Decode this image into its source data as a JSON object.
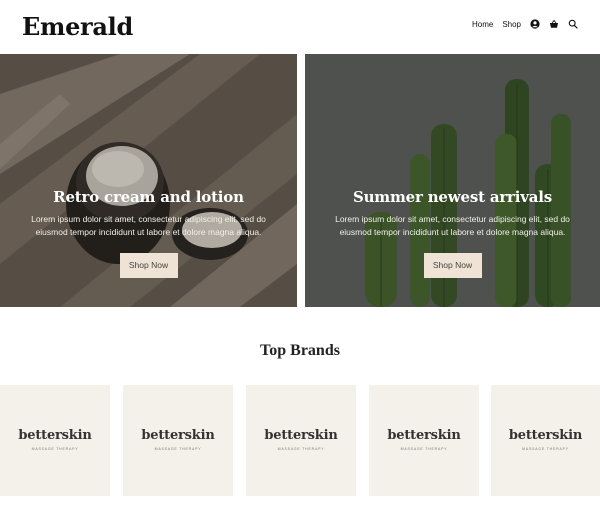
{
  "header": {
    "logo": "Emerald",
    "nav": [
      {
        "label": "Home"
      },
      {
        "label": "Shop"
      }
    ],
    "icons": [
      "account-icon",
      "basket-icon",
      "search-icon"
    ]
  },
  "heroes": [
    {
      "title": "Retro cream and lotion",
      "text": "Lorem ipsum dolor sit amet, consectetur adipiscing elit, sed do eiusmod tempor incididunt ut labore et dolore magna aliqua.",
      "button": "Shop Now"
    },
    {
      "title": "Summer newest arrivals",
      "text": "Lorem ipsum dolor sit amet, consectetur adipiscing elit, sed do eiusmod tempor incididunt ut labore et dolore magna aliqua.",
      "button": "Shop Now"
    }
  ],
  "brands_section": {
    "title": "Top Brands",
    "items": [
      {
        "name": "betterskin",
        "tagline": "MASSAGE THERAPY"
      },
      {
        "name": "betterskin",
        "tagline": "MASSAGE THERAPY"
      },
      {
        "name": "betterskin",
        "tagline": "MASSAGE THERAPY"
      },
      {
        "name": "betterskin",
        "tagline": "MASSAGE THERAPY"
      },
      {
        "name": "betterskin",
        "tagline": "MASSAGE THERAPY"
      }
    ]
  },
  "colors": {
    "button_bg": "#efe3d5",
    "brand_card_bg": "#f4f1ea"
  }
}
